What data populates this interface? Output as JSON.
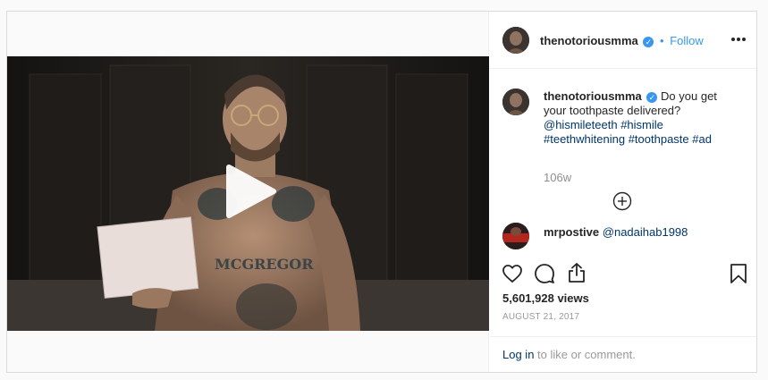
{
  "post": {
    "author": {
      "username": "thenotoriousmma",
      "verified_mark": "✓",
      "separator": "•",
      "follow_label": "Follow"
    },
    "more_icon": "more-horizontal-icon",
    "caption": {
      "username": "thenotoriousmma",
      "text": "Do you get your toothpaste delivered?",
      "mention": "@hismileteeth",
      "hashtags": [
        "#hismile",
        "#teethwhitening",
        "#toothpaste",
        "#ad"
      ]
    },
    "time_ago": "106w",
    "load_more_icon": "plus-circle-icon",
    "comments": [
      {
        "username": "mrpostive",
        "mention": "@nadaihab1998"
      }
    ],
    "video": {
      "play_icon": "play-icon",
      "tattoo_text": "MCGREGOR"
    },
    "actions": {
      "like_icon": "heart-icon",
      "comment_icon": "comment-icon",
      "share_icon": "share-icon",
      "save_icon": "bookmark-icon"
    },
    "views": "5,601,928 views",
    "date": "AUGUST 21, 2017",
    "login_prompt": {
      "link": "Log in",
      "rest": "to like or comment."
    }
  },
  "colors": {
    "link_blue": "#3897f0",
    "hashtag_blue": "#003569",
    "muted_gray": "#8e8e8e",
    "border": "#dbdbdb"
  }
}
